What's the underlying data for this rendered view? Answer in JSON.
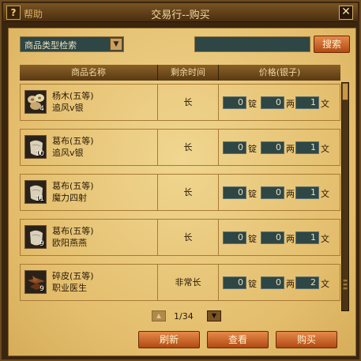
{
  "window": {
    "help_icon": "?",
    "help_label": "帮助",
    "title": "交易行--购买",
    "close_icon": "✕"
  },
  "filter": {
    "category_select": "商品类型检索",
    "search_value": "",
    "search_button": "搜索"
  },
  "table": {
    "headers": [
      "商品名称",
      "剩余时间",
      "价格(银子)"
    ],
    "rows": [
      {
        "icon": "wood-icon",
        "count": "4",
        "name": "杨木(五等)",
        "seller": "追风v银",
        "time": "长",
        "ding": "0",
        "liang": "0",
        "wen": "1"
      },
      {
        "icon": "cloth-icon",
        "count": "10",
        "name": "葛布(五等)",
        "seller": "追风v银",
        "time": "长",
        "ding": "0",
        "liang": "0",
        "wen": "1"
      },
      {
        "icon": "cloth-icon",
        "count": "11",
        "name": "葛布(五等)",
        "seller": "魔力四射",
        "time": "长",
        "ding": "0",
        "liang": "0",
        "wen": "1"
      },
      {
        "icon": "cloth-icon",
        "count": "9",
        "name": "葛布(五等)",
        "seller": "欧阳燕燕",
        "time": "长",
        "ding": "0",
        "liang": "0",
        "wen": "1"
      },
      {
        "icon": "leather-icon",
        "count": "9",
        "name": "碎皮(五等)",
        "seller": "职业医生",
        "time": "非常长",
        "ding": "0",
        "liang": "0",
        "wen": "2"
      }
    ],
    "units": {
      "ding": "锭",
      "liang": "两",
      "wen": "文"
    }
  },
  "pager": {
    "text": "1/34"
  },
  "actions": {
    "refresh": "刷新",
    "view": "查看",
    "buy": "购买"
  }
}
